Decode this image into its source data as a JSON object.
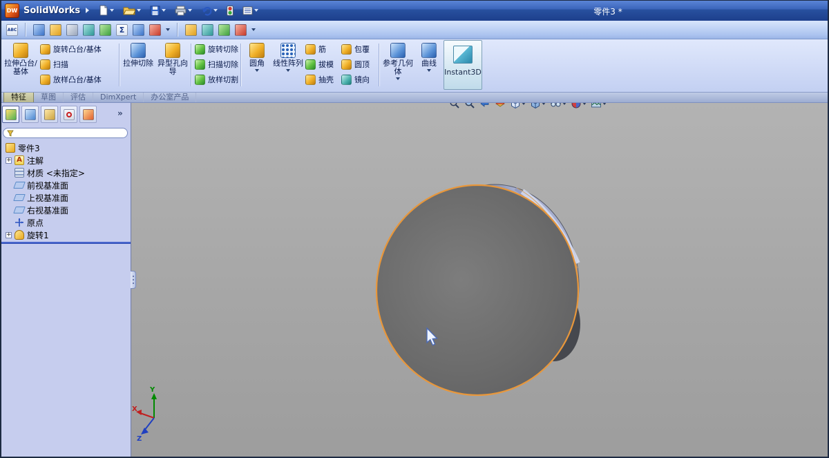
{
  "titlebar": {
    "logo": "DW",
    "app_name": "SolidWorks",
    "doc_title": "零件3 *"
  },
  "ui": {
    "abc": "ABC",
    "sigma": "Σ",
    "plus": "+",
    "chevrons": "»",
    "annotation_letter": "A"
  },
  "ribbon": {
    "extrude_boss": "拉伸凸台/基体",
    "revolve_boss": "旋转凸台/基体",
    "sweep": "扫描",
    "loft_boss": "放样凸台/基体",
    "extrude_cut": "拉伸切除",
    "hole_wizard": "异型孔向导",
    "revolve_cut": "旋转切除",
    "sweep_cut": "扫描切除",
    "loft_cut": "放样切割",
    "fillet": "圆角",
    "linear_pattern": "线性阵列",
    "rib": "筋",
    "draft": "拔模",
    "shell": "抽壳",
    "wrap": "包覆",
    "dome": "圆顶",
    "mirror": "镜向",
    "reference_geometry": "参考几何体",
    "curves": "曲线",
    "instant3d": "Instant3D"
  },
  "tabs": {
    "items": [
      "特征",
      "草图",
      "评估",
      "DimXpert",
      "办公室产品"
    ],
    "active": "特征"
  },
  "feature_tree": {
    "root": "零件3",
    "items": [
      {
        "label": "注解"
      },
      {
        "label": "材质 <未指定>"
      },
      {
        "label": "前视基准面"
      },
      {
        "label": "上视基准面"
      },
      {
        "label": "右视基准面"
      },
      {
        "label": "原点"
      },
      {
        "label": "旋转1"
      }
    ]
  },
  "filter": {
    "value": ""
  },
  "triad": {
    "x": "X",
    "y": "Y",
    "z": "Z"
  },
  "colors": {
    "selection_edge": "#e8973b",
    "viewport_bg": "#a8a8a8",
    "rollback_bar": "#2f55c8"
  },
  "toolbar_icons": [
    "spell-check",
    "select-filter",
    "measure",
    "mass-properties",
    "section-properties",
    "check-entity",
    "equations",
    "curvature",
    "statistics",
    "reload",
    "search-settings",
    "design-check",
    "options"
  ],
  "headsup_icons": [
    "zoom-fit",
    "zoom-area",
    "previous-view",
    "section-view",
    "view-orientation",
    "display-style",
    "hide-show-items",
    "edit-appearance",
    "apply-scene"
  ]
}
